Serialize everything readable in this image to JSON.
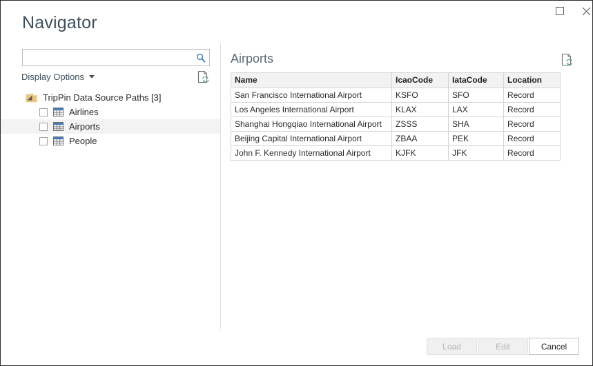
{
  "window": {
    "title": "Navigator",
    "controls": [
      {
        "name": "maximize-button",
        "icon": "maximize-icon",
        "label": "Maximize"
      },
      {
        "name": "close-button",
        "icon": "close-icon",
        "label": "Close"
      }
    ]
  },
  "search": {
    "value": "",
    "placeholder": "",
    "icon": "search-icon"
  },
  "display_options": {
    "label": "Display Options",
    "caret_icon": "chevron-down-icon"
  },
  "refresh_preview": {
    "left_icon": "refresh-document-icon",
    "right_icon": "refresh-document-icon"
  },
  "tree": {
    "root": {
      "label": "TripPin Data Source Paths [3]",
      "expander_icon": "expander-collapse-icon",
      "folder_icon": "folder-icon",
      "expanded": true
    },
    "items": [
      {
        "label": "Airlines",
        "icon": "table-icon",
        "checked": false,
        "selected": false
      },
      {
        "label": "Airports",
        "icon": "table-icon",
        "checked": false,
        "selected": true
      },
      {
        "label": "People",
        "icon": "table-icon",
        "checked": false,
        "selected": false
      }
    ]
  },
  "preview": {
    "title": "Airports",
    "columns": [
      "Name",
      "IcaoCode",
      "IataCode",
      "Location"
    ],
    "rows": [
      [
        "San Francisco International Airport",
        "KSFO",
        "SFO",
        "Record"
      ],
      [
        "Los Angeles International Airport",
        "KLAX",
        "LAX",
        "Record"
      ],
      [
        "Shanghai Hongqiao International Airport",
        "ZSSS",
        "SHA",
        "Record"
      ],
      [
        "Beijing Capital International Airport",
        "ZBAA",
        "PEK",
        "Record"
      ],
      [
        "John F. Kennedy International Airport",
        "KJFK",
        "JFK",
        "Record"
      ]
    ]
  },
  "footer": {
    "buttons": [
      {
        "name": "load-button",
        "label": "Load",
        "enabled": false
      },
      {
        "name": "edit-button",
        "label": "Edit",
        "enabled": false
      },
      {
        "name": "cancel-button",
        "label": "Cancel",
        "enabled": true
      }
    ]
  },
  "colors": {
    "title_text": "#3f4f5c",
    "preview_title_text": "#5d6b75",
    "search_icon": "#2f6fa8",
    "folder": "#e8c67f",
    "table_icon_header": "#4a78b5",
    "refresh_badge": "#4c9e8a",
    "selection_row": "#f3f3f3",
    "table_header_bg": "#f2f2f2",
    "border": "#d4d4d4"
  }
}
